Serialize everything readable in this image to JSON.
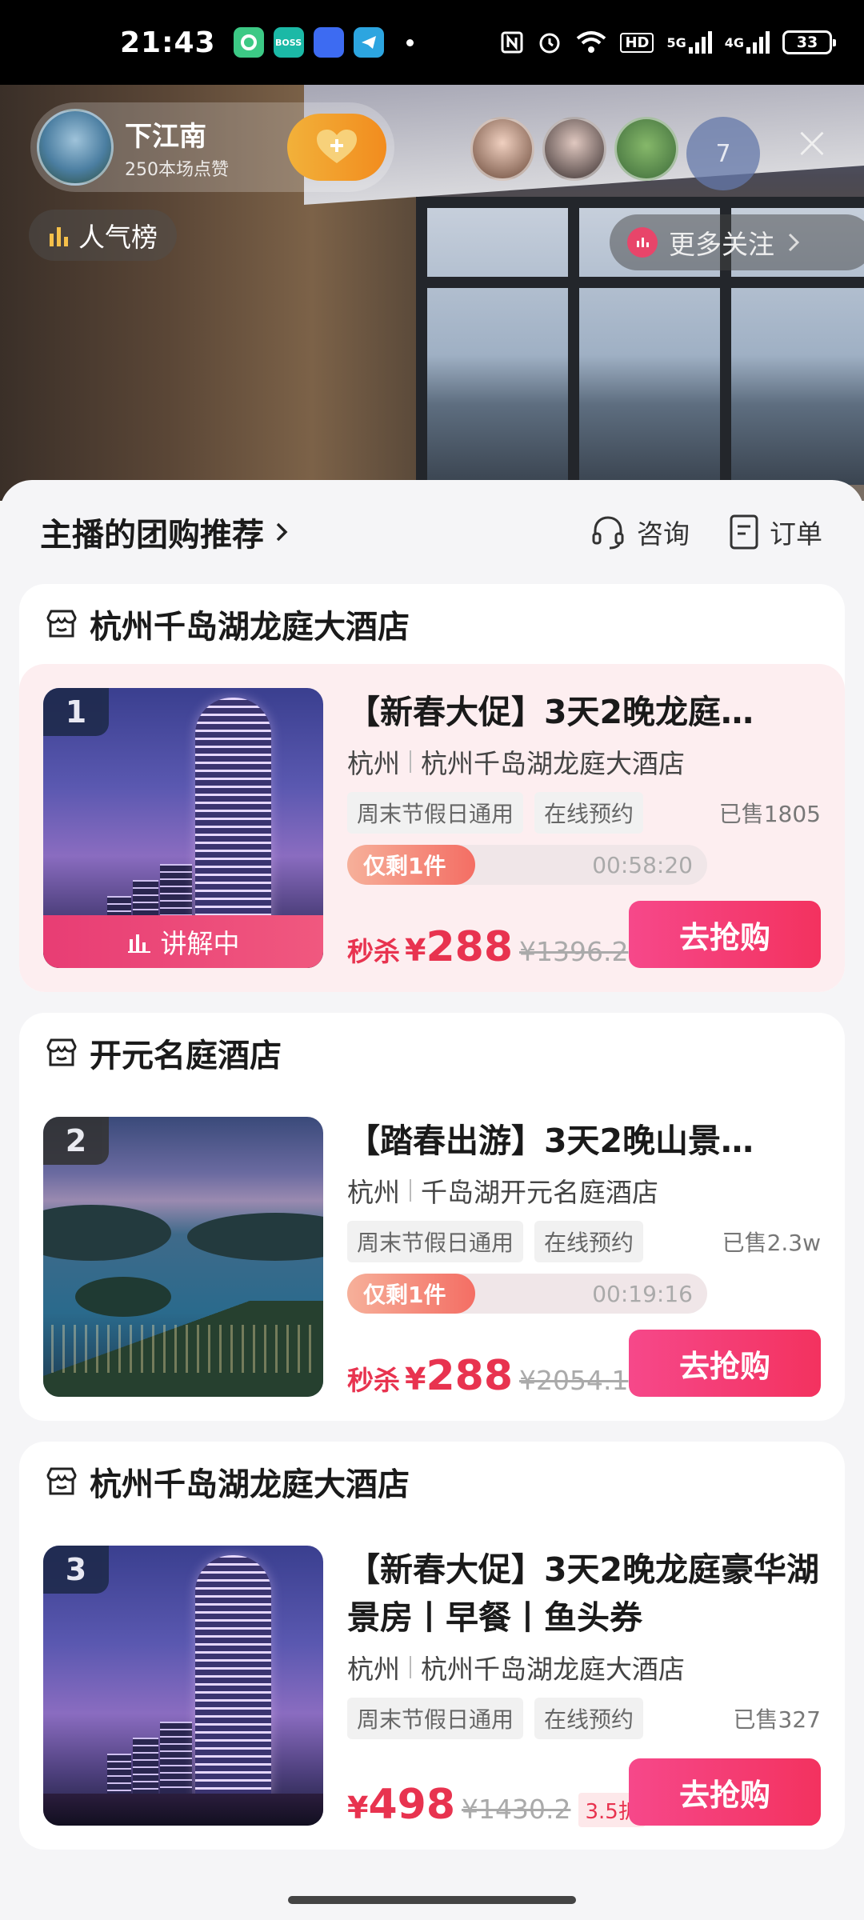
{
  "status_bar": {
    "time": "21:43",
    "apps": [
      {
        "icon": "green-circle-app-icon",
        "color": "#3cc985",
        "label": ""
      },
      {
        "icon": "boss-zhipin-icon",
        "color": "#1bb9a6",
        "label": "BOSS"
      },
      {
        "icon": "blue-app-icon",
        "color": "#3d6bf2",
        "label": ""
      },
      {
        "icon": "telegram-icon",
        "color": "#2ca5e0",
        "label": ""
      }
    ],
    "network_hd": "HD",
    "signal1": "5G",
    "signal2": "4G",
    "battery": "33"
  },
  "live": {
    "host_name": "下江南",
    "host_likes": "250本场点赞",
    "viewer_count": "7",
    "popular_label": "人气榜",
    "more_follow_label": "更多关注",
    "viewers": [
      {
        "color": "#d7b4a2"
      },
      {
        "color": "#8e7d78"
      },
      {
        "color": "#4f8a4f"
      }
    ]
  },
  "sheet": {
    "title": "主播的团购推荐",
    "consult_label": "咨询",
    "orders_label": "订单"
  },
  "products": [
    {
      "shop": "杭州千岛湖龙庭大酒店",
      "rank": "1",
      "title": "【新春大促】3天2晚龙庭…",
      "city": "杭州",
      "hotel": "杭州千岛湖龙庭大酒店",
      "tags": [
        "周末节假日通用",
        "在线预约"
      ],
      "sold": "已售1805",
      "stock": "仅剩1件",
      "countdown": "00:58:20",
      "flash_label": "秒杀",
      "yen": "¥",
      "price": "288",
      "original_price": "¥1396.2",
      "buy_label": "去抢购",
      "explaining": "讲解中"
    },
    {
      "shop": "开元名庭酒店",
      "rank": "2",
      "title": "【踏春出游】3天2晚山景…",
      "city": "杭州",
      "hotel": "千岛湖开元名庭酒店",
      "tags": [
        "周末节假日通用",
        "在线预约"
      ],
      "sold": "已售2.3w",
      "stock": "仅剩1件",
      "countdown": "00:19:16",
      "flash_label": "秒杀",
      "yen": "¥",
      "price": "288",
      "original_price": "¥2054.1",
      "buy_label": "去抢购"
    },
    {
      "shop": "杭州千岛湖龙庭大酒店",
      "rank": "3",
      "title": "【新春大促】3天2晚龙庭豪华湖景房丨早餐丨鱼头券",
      "city": "杭州",
      "hotel": "杭州千岛湖龙庭大酒店",
      "tags": [
        "周末节假日通用",
        "在线预约"
      ],
      "sold": "已售327",
      "yen": "¥",
      "price": "498",
      "original_price": "¥1430.2",
      "discount": "3.5折",
      "buy_label": "去抢购"
    }
  ],
  "colors": {
    "accent": "#f3325f",
    "price": "#e8334f",
    "highlight_bg": "#fdeef0"
  }
}
